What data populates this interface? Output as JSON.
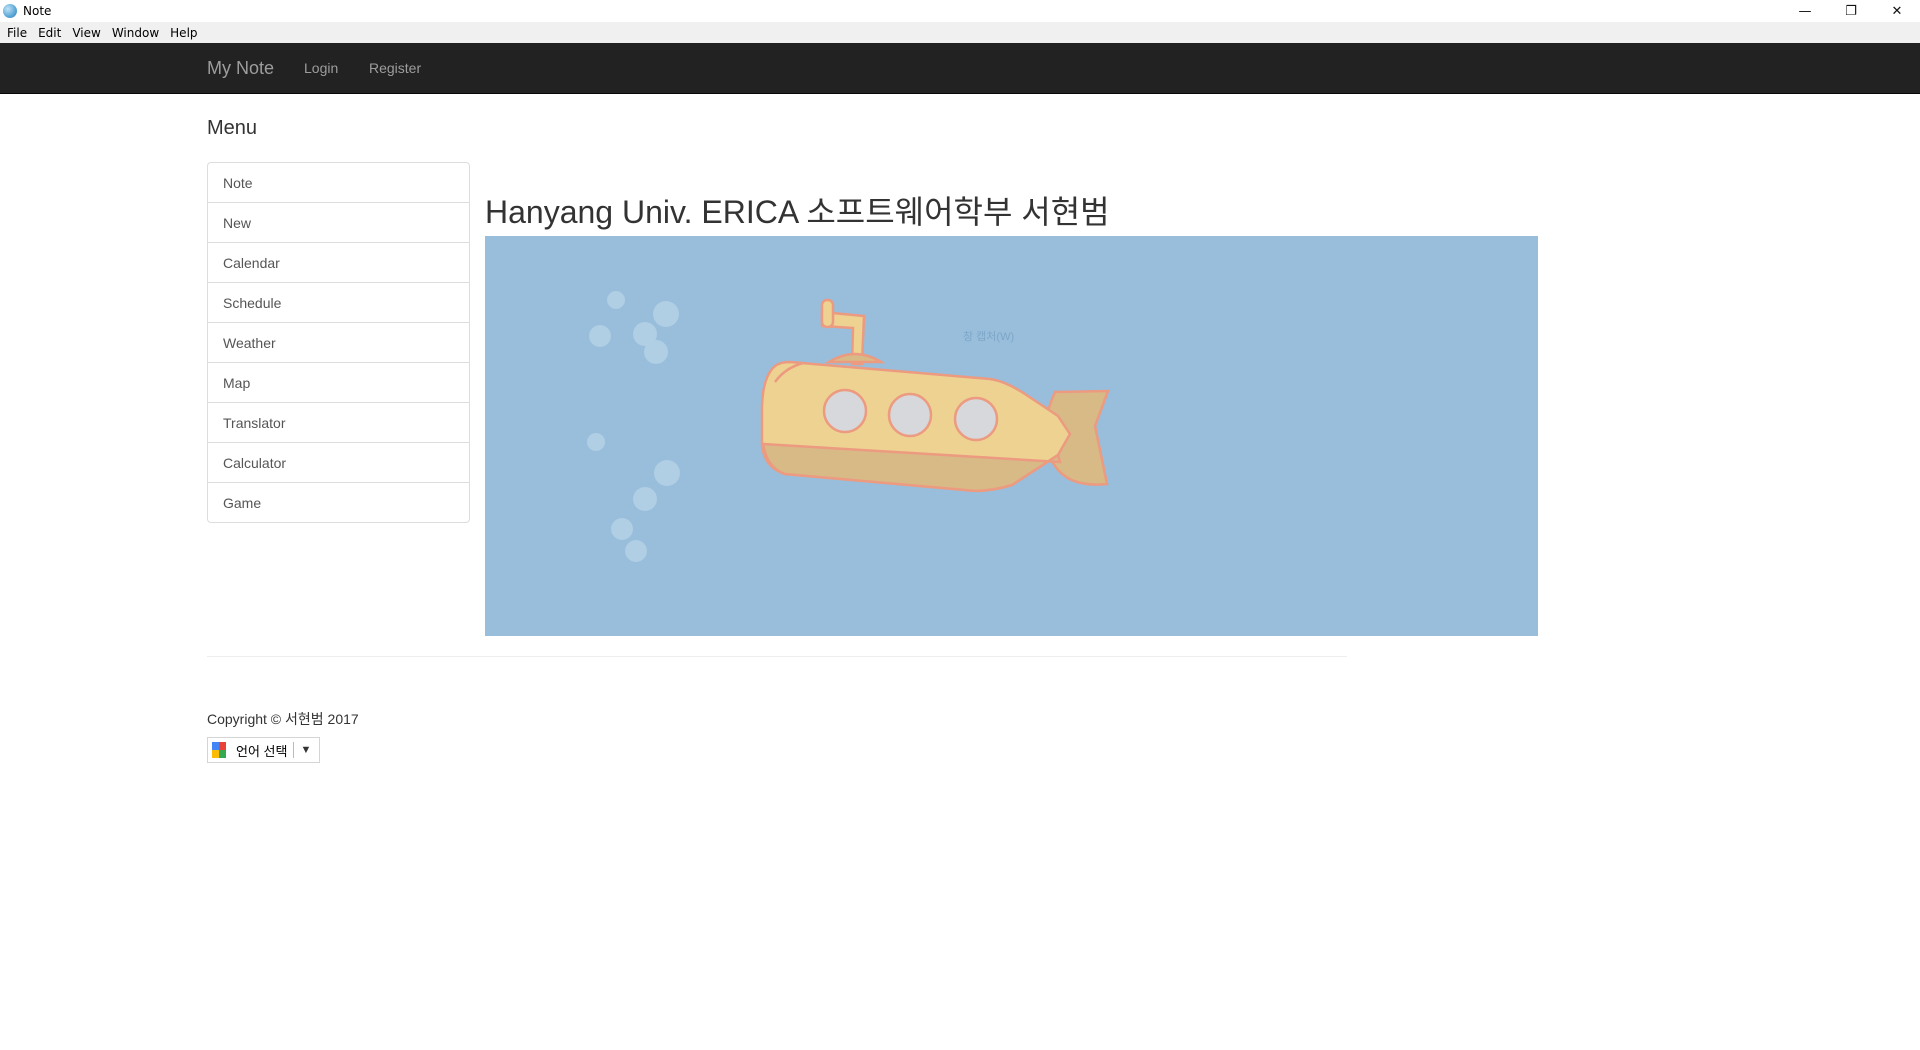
{
  "window": {
    "title": "Note",
    "controls": {
      "minimize": "—",
      "restore": "❐",
      "close": "✕"
    }
  },
  "menubar": {
    "items": [
      "File",
      "Edit",
      "View",
      "Window",
      "Help"
    ]
  },
  "navbar": {
    "brand": "My Note",
    "links": [
      "Login",
      "Register"
    ]
  },
  "sidebar": {
    "heading": "Menu",
    "items": [
      "Note",
      "New",
      "Calendar",
      "Schedule",
      "Weather",
      "Map",
      "Translator",
      "Calculator",
      "Game"
    ]
  },
  "main": {
    "heading": "Hanyang Univ. ERICA 소프트웨어학부 서현범",
    "hero": {
      "caption": "창 캡처(W)",
      "illustration": "submarine-illustration",
      "bg_color": "#98bedb"
    }
  },
  "footer": {
    "copyright": "Copyright © 서현범 2017",
    "language_selector": {
      "label": "언어 선택",
      "arrow": "▼"
    }
  }
}
